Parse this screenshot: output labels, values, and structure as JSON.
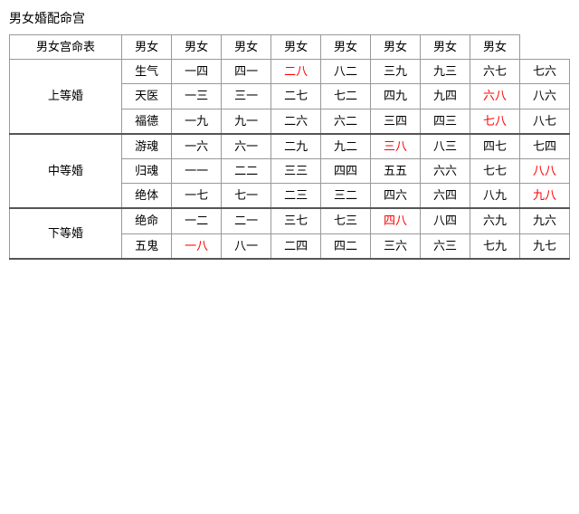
{
  "title": "男女婚配命宫",
  "table": {
    "col_headers": [
      "男女宫命表",
      "男女",
      "男女",
      "男女",
      "男女",
      "男女",
      "男女",
      "男女",
      "男女"
    ],
    "row_groups": [
      {
        "group_label": "上等婚",
        "rows": [
          {
            "sub_label": "生气",
            "cells": [
              {
                "text": "一四",
                "red": false
              },
              {
                "text": "四一",
                "red": false
              },
              {
                "text": "二八",
                "red": true
              },
              {
                "text": "八二",
                "red": false
              },
              {
                "text": "三九",
                "red": false
              },
              {
                "text": "九三",
                "red": false
              },
              {
                "text": "六七",
                "red": false
              },
              {
                "text": "七六",
                "red": false
              }
            ]
          },
          {
            "sub_label": "天医",
            "cells": [
              {
                "text": "一三",
                "red": false
              },
              {
                "text": "三一",
                "red": false
              },
              {
                "text": "二七",
                "red": false
              },
              {
                "text": "七二",
                "red": false
              },
              {
                "text": "四九",
                "red": false
              },
              {
                "text": "九四",
                "red": false
              },
              {
                "text": "六八",
                "red": true
              },
              {
                "text": "八六",
                "red": false
              }
            ]
          },
          {
            "sub_label": "福德",
            "cells": [
              {
                "text": "一九",
                "red": false
              },
              {
                "text": "九一",
                "red": false
              },
              {
                "text": "二六",
                "red": false
              },
              {
                "text": "六二",
                "red": false
              },
              {
                "text": "三四",
                "red": false
              },
              {
                "text": "四三",
                "red": false
              },
              {
                "text": "七八",
                "red": true
              },
              {
                "text": "八七",
                "red": false
              }
            ]
          }
        ]
      },
      {
        "group_label": "中等婚",
        "rows": [
          {
            "sub_label": "游魂",
            "cells": [
              {
                "text": "一六",
                "red": false
              },
              {
                "text": "六一",
                "red": false
              },
              {
                "text": "二九",
                "red": false
              },
              {
                "text": "九二",
                "red": false
              },
              {
                "text": "三八",
                "red": true
              },
              {
                "text": "八三",
                "red": false
              },
              {
                "text": "四七",
                "red": false
              },
              {
                "text": "七四",
                "red": false
              }
            ]
          },
          {
            "sub_label": "归魂",
            "cells": [
              {
                "text": "一一",
                "red": false
              },
              {
                "text": "二二",
                "red": false
              },
              {
                "text": "三三",
                "red": false
              },
              {
                "text": "四四",
                "red": false
              },
              {
                "text": "五五",
                "red": false
              },
              {
                "text": "六六",
                "red": false
              },
              {
                "text": "七七",
                "red": false
              },
              {
                "text": "八八",
                "red": true
              }
            ]
          },
          {
            "sub_label": "绝体",
            "cells": [
              {
                "text": "一七",
                "red": false
              },
              {
                "text": "七一",
                "red": false
              },
              {
                "text": "二三",
                "red": false
              },
              {
                "text": "三二",
                "red": false
              },
              {
                "text": "四六",
                "red": false
              },
              {
                "text": "六四",
                "red": false
              },
              {
                "text": "八九",
                "red": false
              },
              {
                "text": "九八",
                "red": true
              }
            ]
          }
        ]
      },
      {
        "group_label": "下等婚",
        "rows": [
          {
            "sub_label": "绝命",
            "cells": [
              {
                "text": "一二",
                "red": false
              },
              {
                "text": "二一",
                "red": false
              },
              {
                "text": "三七",
                "red": false
              },
              {
                "text": "七三",
                "red": false
              },
              {
                "text": "四八",
                "red": true
              },
              {
                "text": "八四",
                "red": false
              },
              {
                "text": "六九",
                "red": false
              },
              {
                "text": "九六",
                "red": false
              }
            ]
          },
          {
            "sub_label": "五鬼",
            "cells": [
              {
                "text": "一八",
                "red": true
              },
              {
                "text": "八一",
                "red": false
              },
              {
                "text": "二四",
                "red": false
              },
              {
                "text": "四二",
                "red": false
              },
              {
                "text": "三六",
                "red": false
              },
              {
                "text": "六三",
                "red": false
              },
              {
                "text": "七九",
                "red": false
              },
              {
                "text": "九七",
                "red": false
              }
            ]
          }
        ]
      }
    ]
  }
}
